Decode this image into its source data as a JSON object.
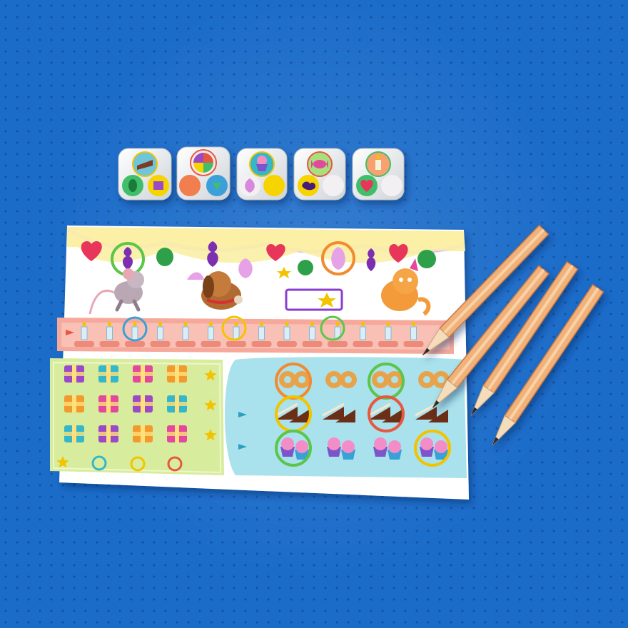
{
  "scene": {
    "background_color": "#1b6cc9",
    "dice_count": 5,
    "pencil_count": 4,
    "dice": [
      {
        "top": "cake-slice-icon",
        "faces": [
          "balloon-icon",
          "present-icon"
        ]
      },
      {
        "top": "pie-icon",
        "faces": [
          "donut-icon",
          "pie-icon"
        ]
      },
      {
        "top": "cupcake-icon",
        "faces": [
          "pear-balloon-icon",
          "candy-icon"
        ]
      },
      {
        "top": "candy-icon",
        "faces": [
          "grape-balloon-icon",
          "present-icon"
        ]
      },
      {
        "top": "candle-icon",
        "faces": [
          "heart-balloon-icon",
          "candle-icon"
        ]
      }
    ],
    "colors": {
      "sheet": "#ffffff",
      "balloon_band": "#fbf0a6",
      "candle_track": "#f6a99b",
      "gift_panel": "#d8ec9d",
      "treat_panel": "#a9e2ec",
      "pencil": "#f0b27a"
    }
  }
}
